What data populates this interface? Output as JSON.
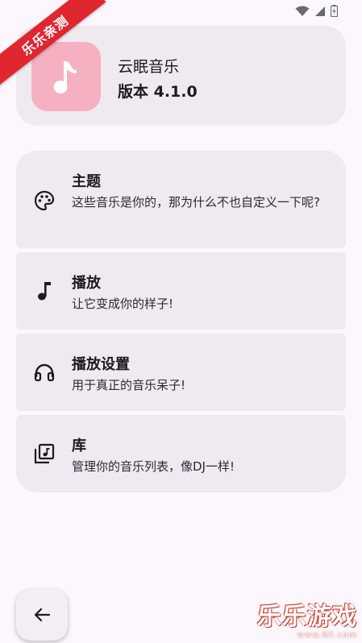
{
  "watermark": {
    "ribbon_text": "乐乐亲测",
    "corner_text": "乐乐游戏",
    "corner_url": "www.6ll.com"
  },
  "about": {
    "app_name": "云眠音乐",
    "version": "版本 4.1.0",
    "icon": "music-note-icon"
  },
  "settings": [
    {
      "title": "主题",
      "description": "这些音乐是你的，那为什么不也自定义一下呢?",
      "icon": "palette-icon"
    },
    {
      "title": "播放",
      "description": "让它变成你的样子!",
      "icon": "music-note-icon"
    },
    {
      "title": "播放设置",
      "description": "用于真正的音乐呆子!",
      "icon": "headphones-icon"
    },
    {
      "title": "库",
      "description": "管理你的音乐列表，像DJ一样!",
      "icon": "library-music-icon"
    }
  ],
  "colors": {
    "card_bg": "#efeaf0",
    "page_bg": "#fbf7fc",
    "app_icon_bg": "#f5b0c2"
  }
}
